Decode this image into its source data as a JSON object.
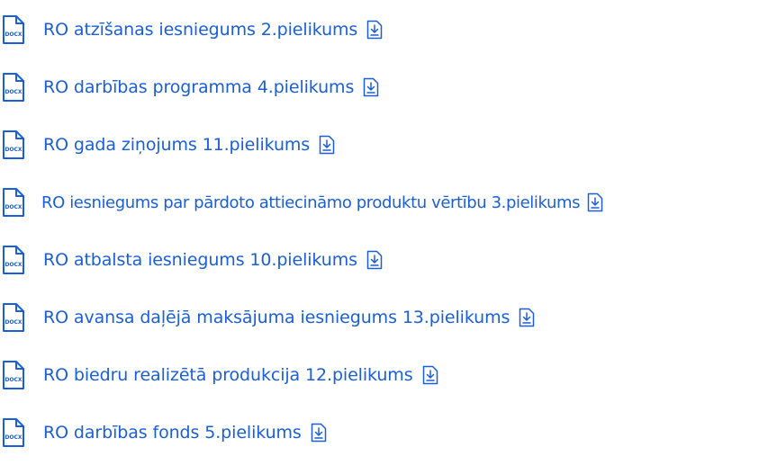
{
  "icons": {
    "file_type_badge": "DOCX",
    "file_icon": "docx-file-icon",
    "download_icon": "download-icon"
  },
  "colors": {
    "link": "#1a5fd8",
    "icon": "#1a5fd8"
  },
  "files": [
    {
      "label": "RO atzīšanas iesniegums 2.pielikums"
    },
    {
      "label": "RO darbības programma 4.pielikums"
    },
    {
      "label": "RO gada ziņojums 11.pielikums"
    },
    {
      "label": "RO iesniegums par pārdoto attiecināmo produktu vērtību 3.pielikums"
    },
    {
      "label": "RO atbalsta iesniegums 10.pielikums"
    },
    {
      "label": "RO avansa daļējā maksājuma iesniegums 13.pielikums"
    },
    {
      "label": "RO biedru realizētā produkcija 12.pielikums"
    },
    {
      "label": "RO darbības fonds 5.pielikums"
    }
  ]
}
